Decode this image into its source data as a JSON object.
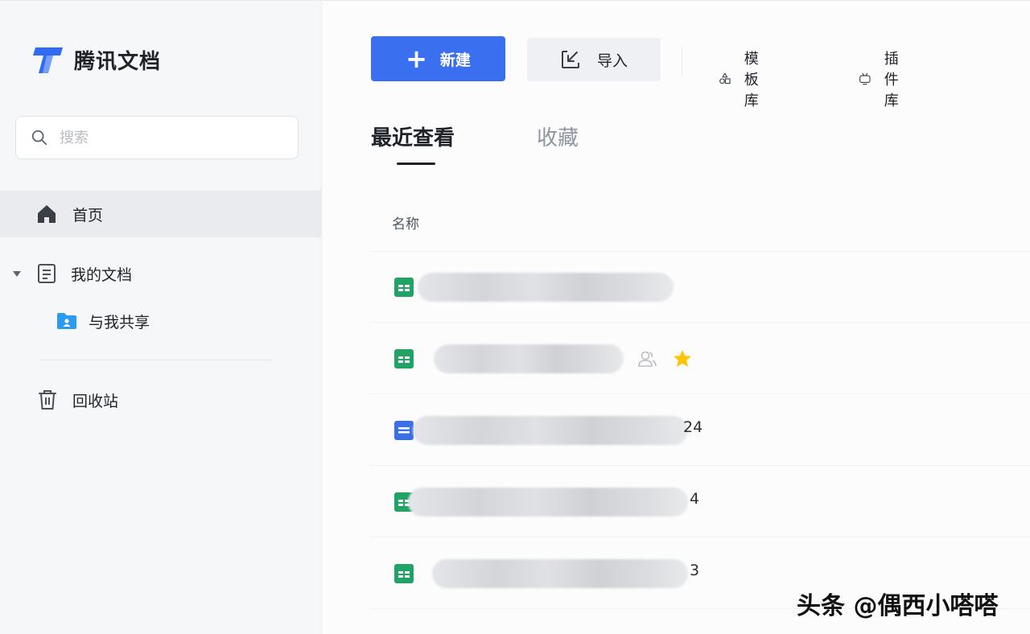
{
  "sidebar": {
    "app_name": "腾讯文档",
    "search": {
      "placeholder": "搜索",
      "value": ""
    },
    "nav": {
      "home": "首页",
      "my_docs": "我的文档",
      "shared_with_me": "与我共享",
      "trash": "回收站"
    }
  },
  "toolbar": {
    "new_label": "新建",
    "import_label": "导入",
    "templates_label": "模板库",
    "plugins_label": "插件库"
  },
  "tabs": [
    {
      "label": "最近查看",
      "active": true
    },
    {
      "label": "收藏",
      "active": false
    }
  ],
  "list": {
    "column_header": "名称",
    "rows": [
      {
        "icon": "sheet-file-icon",
        "visible_suffix": "",
        "shared": false,
        "starred": false
      },
      {
        "icon": "sheet-file-icon",
        "visible_suffix": "",
        "shared": true,
        "starred": true
      },
      {
        "icon": "doc-file-icon",
        "visible_suffix": "24",
        "shared": false,
        "starred": false
      },
      {
        "icon": "sheet-file-icon",
        "visible_suffix": "4",
        "shared": false,
        "starred": false
      },
      {
        "icon": "sheet-file-icon",
        "visible_suffix": "3",
        "shared": false,
        "starred": false
      }
    ]
  },
  "watermark": "头条 @偶西小嗒嗒",
  "colors": {
    "primary": "#3a6ff0",
    "sheet_green": "#21a366",
    "doc_blue": "#3b6fe8",
    "star_yellow": "#ffc300",
    "sidebar_active_bg": "#e9ebef"
  }
}
